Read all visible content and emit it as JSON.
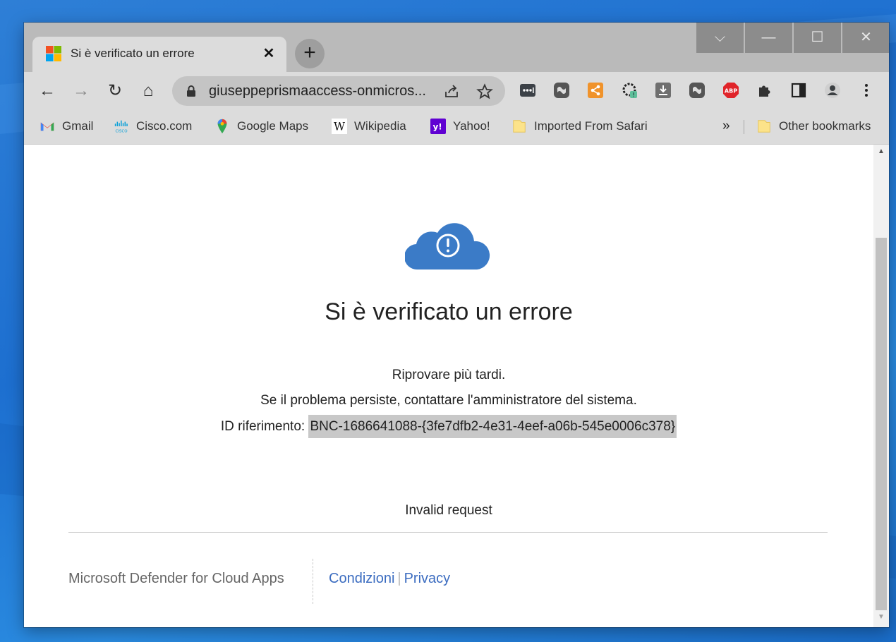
{
  "tab": {
    "title": "Si è verificato un errore",
    "close_glyph": "✕"
  },
  "new_tab_glyph": "+",
  "window_controls": {
    "dropdown": "⌵",
    "minimize": "—",
    "maximize": "☐",
    "close": "✕"
  },
  "nav": {
    "back": "←",
    "forward": "→",
    "reload": "↻",
    "home": "⌂"
  },
  "omnibox": {
    "url": "giuseppeprismaaccess-onmicros..."
  },
  "bookmarks": {
    "items": [
      "Gmail",
      "Cisco.com",
      "Google Maps",
      "Wikipedia",
      "Yahoo!",
      "Imported From Safari"
    ],
    "overflow": "»",
    "other": "Other bookmarks"
  },
  "page": {
    "title": "Si è verificato un errore",
    "line1": "Riprovare più tardi.",
    "line2": "Se il problema persiste, contattare l'amministratore del sistema.",
    "ref_label": "ID riferimento: ",
    "ref_id": "BNC-1686641088-{3fe7dfb2-4e31-4eef-a06b-545e0006c378}",
    "detail": "Invalid request"
  },
  "footer": {
    "brand": "Microsoft Defender for Cloud Apps",
    "link_terms": "Condizioni",
    "link_sep": "|",
    "link_privacy": "Privacy"
  },
  "extensions": [
    "lastpass-icon",
    "webex-icon",
    "share-ext-icon",
    "sync-ext-icon",
    "download-icon",
    "webex-icon-2",
    "adblock-plus-icon",
    "extensions-puzzle-icon",
    "side-panel-icon",
    "profile-icon",
    "menu-kebab-icon"
  ],
  "colors": {
    "accent_cloud": "#3b7bc7",
    "link": "#3b6cc0"
  }
}
